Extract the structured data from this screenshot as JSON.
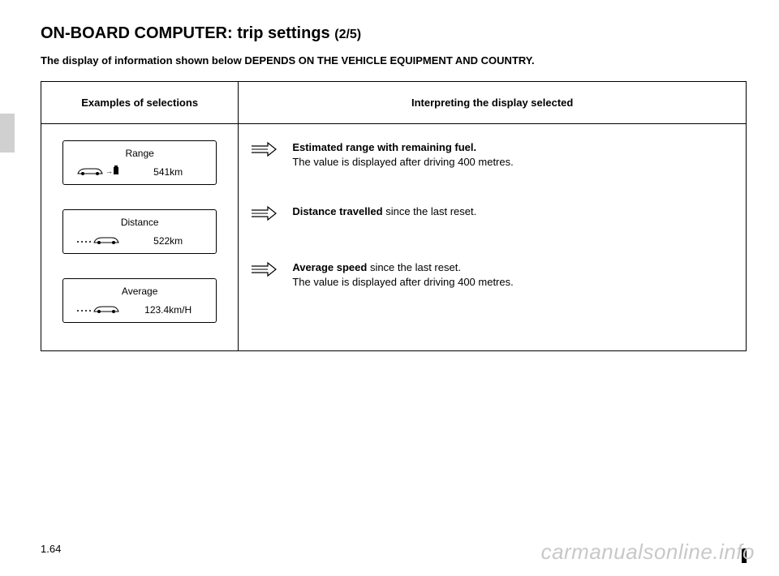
{
  "header": {
    "title_main": "ON-BOARD COMPUTER: trip settings",
    "title_part": "(2/5)",
    "subtitle": "The display of information shown below DEPENDS ON THE VEHICLE EQUIPMENT AND COUNTRY."
  },
  "table": {
    "col1_header": "Examples of selections",
    "col2_header": "Interpreting the display selected",
    "rows": [
      {
        "display_label": "Range",
        "display_value": "541km",
        "interp_bold": "Estimated range with remaining fuel.",
        "interp_rest": "The value is displayed after driving 400 metres.",
        "icon": "car-fuel"
      },
      {
        "display_label": "Distance",
        "display_value": "522km",
        "interp_bold": "Distance travelled",
        "interp_rest_inline": " since the last reset.",
        "interp_rest": "",
        "icon": "car-trail"
      },
      {
        "display_label": "Average",
        "display_value": "123.4km/H",
        "interp_bold": "Average speed",
        "interp_rest_inline": " since the last reset.",
        "interp_rest": "The value is displayed after driving 400 metres.",
        "icon": "car-trail"
      }
    ]
  },
  "footer": {
    "page_number": "1.64",
    "watermark": "carmanualsonline.info"
  }
}
